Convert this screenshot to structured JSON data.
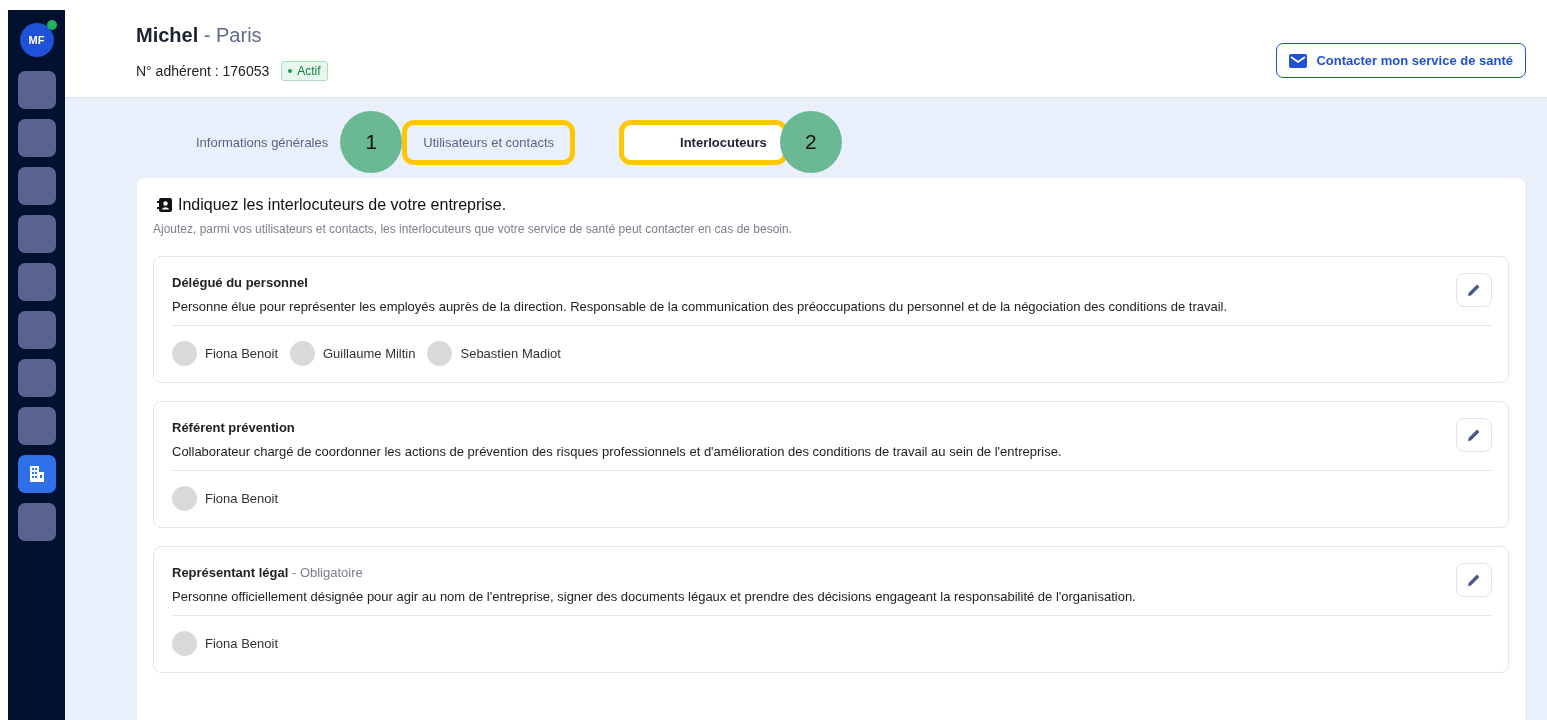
{
  "sidebar": {
    "avatar": {
      "initials": "MF",
      "online": true
    },
    "items": [
      {
        "kind": "blank",
        "selected": false
      },
      {
        "kind": "blank",
        "selected": false
      },
      {
        "kind": "blank",
        "selected": false
      },
      {
        "kind": "blank",
        "selected": false
      },
      {
        "kind": "blank",
        "selected": false
      },
      {
        "kind": "blank",
        "selected": false
      },
      {
        "kind": "blank",
        "selected": false
      },
      {
        "kind": "blank",
        "selected": false
      },
      {
        "kind": "building",
        "selected": true
      },
      {
        "kind": "blank",
        "selected": false
      }
    ]
  },
  "header": {
    "name": "Michel",
    "separator": "-",
    "city": "Paris",
    "member_number": "N° adhérent : 176053",
    "status": "Actif",
    "contact_button": "Contacter mon service de santé"
  },
  "tabs": [
    {
      "label": "Informations générales",
      "selected": false,
      "highlighted": false
    },
    {
      "label": "Utilisateurs et contacts",
      "selected": false,
      "highlighted": true,
      "callout_before": "1"
    },
    {
      "label": "Interlocuteurs",
      "selected": true,
      "highlighted": true,
      "callout_after": "2"
    }
  ],
  "panel": {
    "title": "Indiquez les interlocuteurs de votre entreprise.",
    "subtitle": "Ajoutez, parmi vos utilisateurs et contacts, les interlocuteurs que votre service de santé peut contacter en cas de besoin.",
    "roles": [
      {
        "title": "Délégué du personnel",
        "description": "Personne élue pour représenter les employés auprès de la direction. Responsable de la communication des préoccupations du personnel et de la négociation des conditions de travail.",
        "people": [
          "Fiona Benoit",
          "Guillaume Miltin",
          "Sebastien Madiot"
        ]
      },
      {
        "title": "Référent prévention",
        "description": "Collaborateur chargé de coordonner les actions de prévention des risques professionnels et d'amélioration des conditions de travail au sein de l'entreprise.",
        "people": [
          "Fiona Benoit"
        ]
      },
      {
        "title": "Représentant légal",
        "separator": "-",
        "note": "Obligatoire",
        "description": "Personne officiellement désignée pour agir au nom de l'entreprise, signer des documents légaux et prendre des décisions engageant la responsabilité de l'organisation.",
        "people": [
          "Fiona Benoit"
        ]
      }
    ]
  }
}
